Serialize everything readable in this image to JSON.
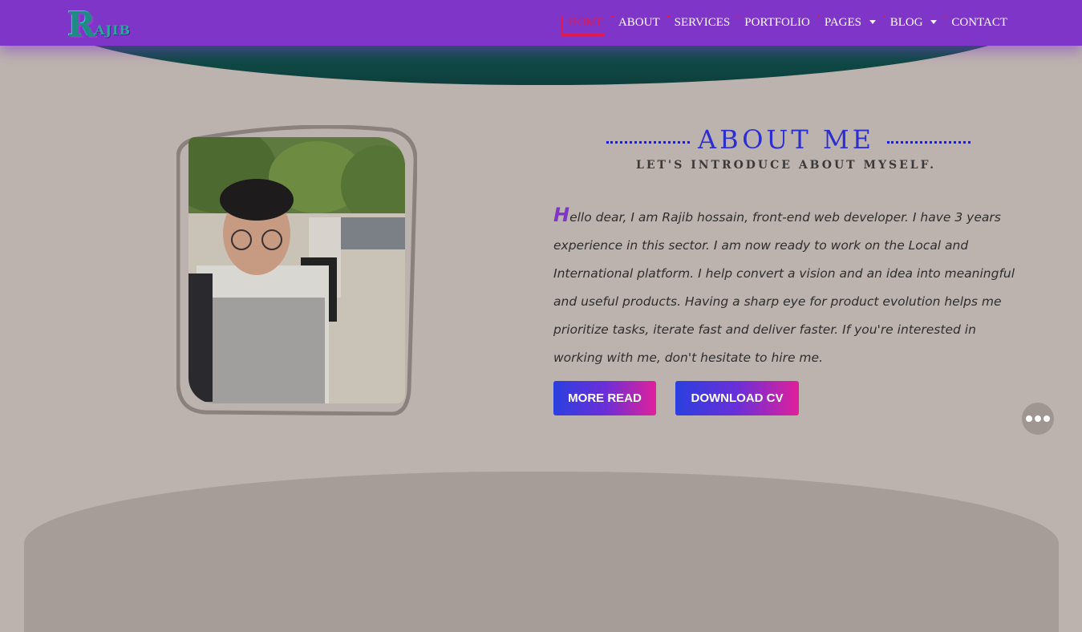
{
  "brand": {
    "logo_initial": "R",
    "logo_rest": "AJIB"
  },
  "nav": {
    "items": [
      {
        "label": "HOME",
        "active": true,
        "dropdown": false
      },
      {
        "label": "ABOUT",
        "active": false,
        "dropdown": false
      },
      {
        "label": "SERVICES",
        "active": false,
        "dropdown": false
      },
      {
        "label": "PORTFOLIO",
        "active": false,
        "dropdown": false
      },
      {
        "label": "PAGES",
        "active": false,
        "dropdown": true
      },
      {
        "label": "BLOG",
        "active": false,
        "dropdown": true
      },
      {
        "label": "CONTACT",
        "active": false,
        "dropdown": false
      }
    ]
  },
  "about": {
    "title": "ABOUT ME",
    "subtitle": "LET'S INTRODUCE ABOUT MYSELF.",
    "dropcap": "H",
    "paragraph": "ello dear, I am Rajib hossain, front-end web developer. I have 3 years experience in this sector. I am now ready to work on the Local and International platform. I help convert a vision and an idea into meaningful and useful products. Having a sharp eye for product evolution helps me prioritize tasks, iterate fast and deliver faster. If you're interested in working with me, don't hesitate to hire me.",
    "buttons": {
      "more_read": "MORE READ",
      "download_cv": "DOWNLOAD CV"
    }
  },
  "colors": {
    "navbar": "#7e35c8",
    "page_bg": "#bcb2ae",
    "active_nav": "#e01a4f",
    "heading": "#2b2fd1",
    "accent": "#7e35c8"
  },
  "icons": {
    "fab": "more-dots-icon",
    "profile_photo": "profile-photo-image"
  }
}
